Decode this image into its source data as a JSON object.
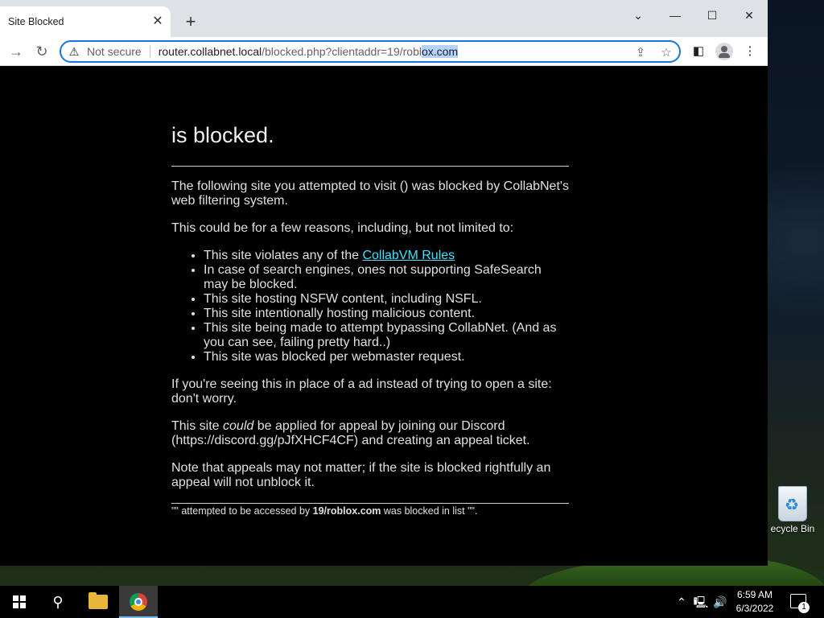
{
  "browser": {
    "tab_title": "Site Blocked",
    "omnibox": {
      "security_label": "Not secure",
      "url_host": "router.collabnet.local",
      "url_path": "/blocked.php?clientaddr=19/robl",
      "url_selected": "ox.com"
    }
  },
  "page": {
    "heading": "is blocked.",
    "intro": "The following site you attempted to visit () was blocked by CollabNet's web filtering system.",
    "reasons_intro": "This could be for a few reasons, including, but not limited to:",
    "reason_1_prefix": "This site violates any of the ",
    "reason_1_link": "CollabVM Rules",
    "reasons": [
      "In case of search engines, ones not supporting SafeSearch may be blocked.",
      "This site hosting NSFW content, including NSFL.",
      "This site intentionally hosting malicious content.",
      "This site being made to attempt bypassing CollabNet. (And as you can see, failing pretty hard..)",
      "This site was blocked per webmaster request."
    ],
    "ad_note": "If you're seeing this in place of a ad instead of trying to open a site: don't worry.",
    "appeal_prefix": "This site ",
    "appeal_emphasis": "could",
    "appeal_suffix": " be applied for appeal by joining our Discord (https://discord.gg/pJfXHCF4CF) and creating an appeal ticket.",
    "appeal_note": "Note that appeals may not matter; if the site is blocked rightfully an appeal will not unblock it.",
    "footer_prefix": "\"\" attempted to be accessed by ",
    "footer_client": "19/roblox.com",
    "footer_suffix": " was blocked in list \"\"."
  },
  "desktop": {
    "recycle_bin_label": "ecycle Bin"
  },
  "taskbar": {
    "time": "6:59 AM",
    "date": "6/3/2022",
    "notification_count": "1"
  }
}
